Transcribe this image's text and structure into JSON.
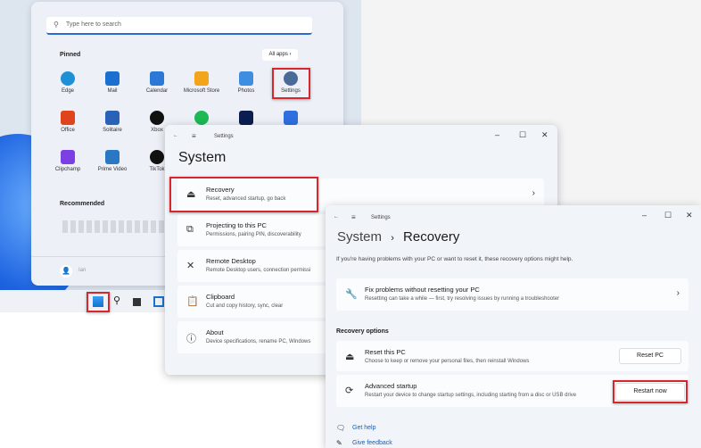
{
  "start_menu": {
    "search_placeholder": "Type here to search",
    "pinned_label": "Pinned",
    "all_apps": "All apps",
    "recommended_label": "Recommended",
    "apps": [
      "Edge",
      "Mail",
      "Calendar",
      "Microsoft Store",
      "Photos",
      "Settings",
      "Office",
      "Solitaire",
      "Xbox",
      "Spotify",
      "Disney+",
      "To Do",
      "Clipchamp",
      "Prime Video",
      "TikTok"
    ],
    "user_name": "Ian"
  },
  "settings_system": {
    "title_bar": "Settings",
    "heading": "System",
    "items": [
      {
        "title": "Recovery",
        "subtitle": "Reset, advanced startup, go back"
      },
      {
        "title": "Projecting to this PC",
        "subtitle": "Permissions, pairing PIN, discoverability"
      },
      {
        "title": "Remote Desktop",
        "subtitle": "Remote Desktop users, connection permissi"
      },
      {
        "title": "Clipboard",
        "subtitle": "Cut and copy history, sync, clear"
      },
      {
        "title": "About",
        "subtitle": "Device specifications, rename PC, Windows"
      }
    ]
  },
  "settings_recovery": {
    "title_bar": "Settings",
    "breadcrumb_parent": "System",
    "breadcrumb_sep": "›",
    "breadcrumb_current": "Recovery",
    "description": "If you're having problems with your PC or want to reset it, these recovery options might help.",
    "fix": {
      "title": "Fix problems without resetting your PC",
      "subtitle": "Resetting can take a while — first, try resolving issues by running a troubleshooter"
    },
    "section_label": "Recovery options",
    "reset": {
      "title": "Reset this PC",
      "subtitle": "Choose to keep or remove your personal files, then reinstall Windows",
      "button": "Reset PC"
    },
    "advanced": {
      "title": "Advanced startup",
      "subtitle": "Restart your device to change startup settings, including starting from a disc or USB drive",
      "button": "Restart now"
    },
    "get_help": "Get help",
    "give_feedback": "Give feedback"
  },
  "colors": {
    "highlight": "#d9262c",
    "accent": "#2a6ad6"
  }
}
